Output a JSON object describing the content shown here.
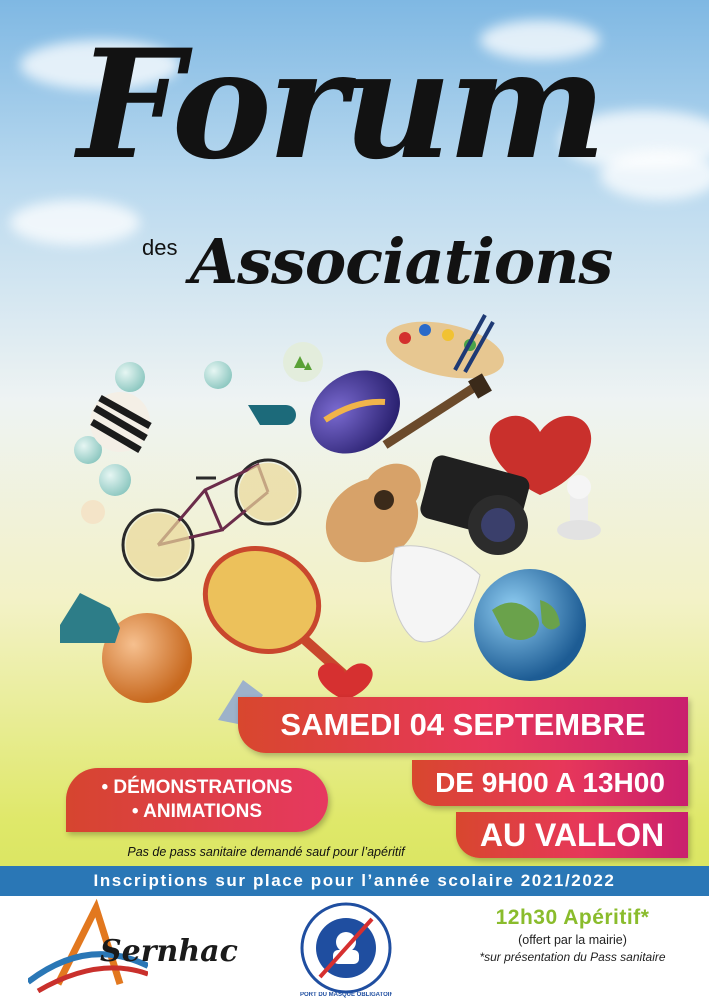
{
  "title": {
    "forum": "Forum",
    "des": "des",
    "associations": "Associations"
  },
  "event": {
    "date": "SAMEDI 04 SEPTEMBRE",
    "time": "DE 9H00 A 13H00",
    "place": "AU VALLON"
  },
  "activities": [
    "• DÉMONSTRATIONS",
    "• ANIMATIONS"
  ],
  "pass_note": "Pas de pass sanitaire demandé sauf pour l’apéritif",
  "registration": "Inscriptions sur place pour l’année scolaire 2021/2022",
  "logo": {
    "name": "Sernhac"
  },
  "mask_badge": {
    "text": "PORT DU MASQUE OBLIGATOIRE"
  },
  "aperitif": {
    "title": "12h30 Apéritif*",
    "offered": "(offert par la mairie)",
    "note": "*sur présentation du Pass sanitaire"
  },
  "colors": {
    "ribbon_start": "#d8472e",
    "ribbon_end": "#c91f6e",
    "registration_bar": "#2a77b6",
    "aperitif_green": "#8abc2c",
    "title_ink": "#121212"
  }
}
